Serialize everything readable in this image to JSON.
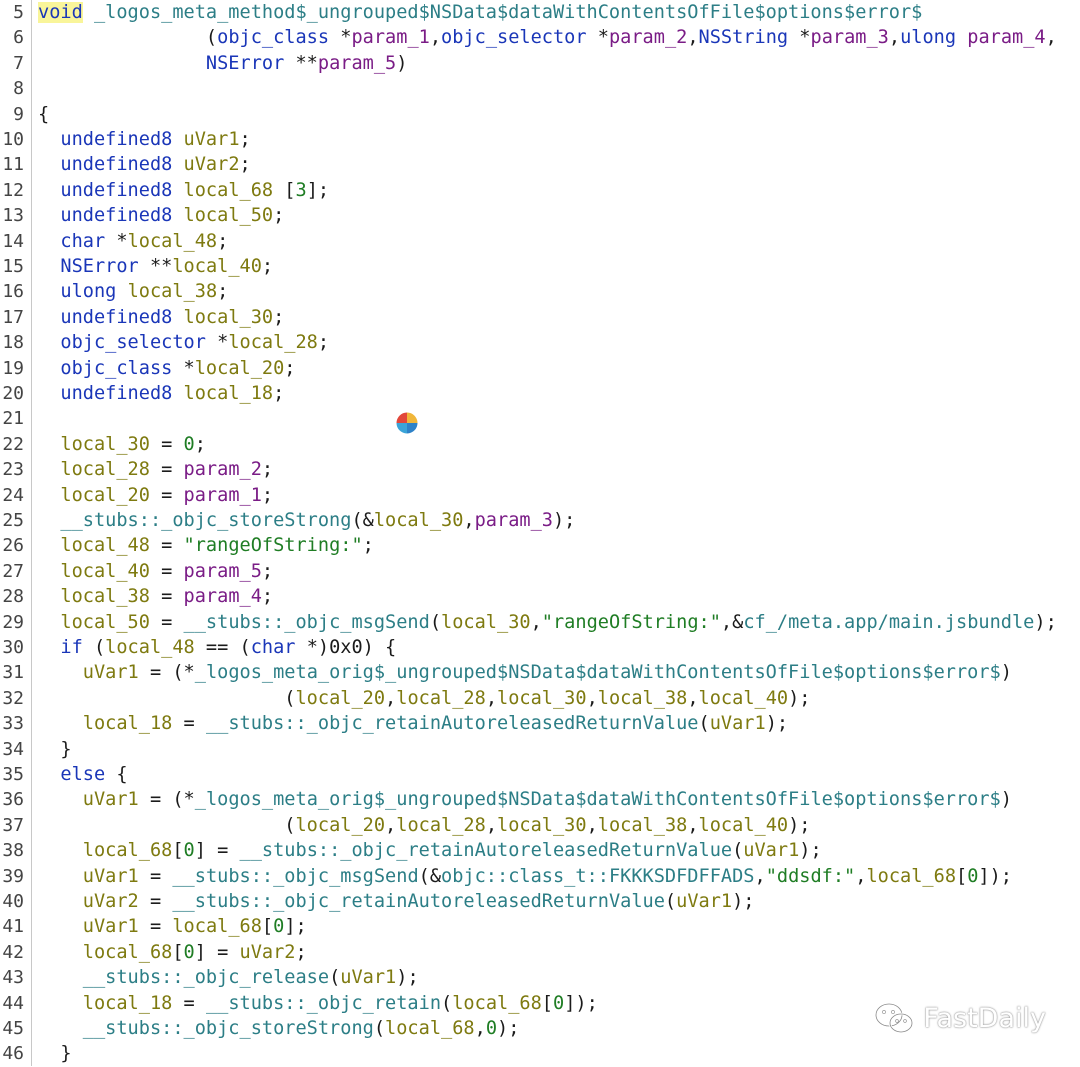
{
  "editor": {
    "lines": [
      {
        "n": "5",
        "t": [
          [
            "hl",
            "void"
          ],
          [
            "fn",
            " _logos_meta_method$_ungrouped$NSData$dataWithContentsOfFile$options$error$"
          ]
        ]
      },
      {
        "n": "6",
        "t": [
          [
            "plain",
            "               ("
          ],
          [
            "kw",
            "objc_class"
          ],
          [
            "plain",
            " *"
          ],
          [
            "param",
            "param_1"
          ],
          [
            "plain",
            ","
          ],
          [
            "kw",
            "objc_selector"
          ],
          [
            "plain",
            " *"
          ],
          [
            "param",
            "param_2"
          ],
          [
            "plain",
            ","
          ],
          [
            "kw",
            "NSString"
          ],
          [
            "plain",
            " *"
          ],
          [
            "param",
            "param_3"
          ],
          [
            "plain",
            ","
          ],
          [
            "kw",
            "ulong"
          ],
          [
            "plain",
            " "
          ],
          [
            "param",
            "param_4"
          ],
          [
            "plain",
            ","
          ]
        ]
      },
      {
        "n": "7",
        "t": [
          [
            "plain",
            "               "
          ],
          [
            "kw",
            "NSError"
          ],
          [
            "plain",
            " **"
          ],
          [
            "param",
            "param_5"
          ],
          [
            "plain",
            ")"
          ]
        ]
      },
      {
        "n": "8",
        "t": []
      },
      {
        "n": "9",
        "t": [
          [
            "plain",
            "{"
          ]
        ]
      },
      {
        "n": "10",
        "t": [
          [
            "plain",
            "  "
          ],
          [
            "kw",
            "undefined8"
          ],
          [
            "plain",
            " "
          ],
          [
            "local",
            "uVar1"
          ],
          [
            "plain",
            ";"
          ]
        ]
      },
      {
        "n": "11",
        "t": [
          [
            "plain",
            "  "
          ],
          [
            "kw",
            "undefined8"
          ],
          [
            "plain",
            " "
          ],
          [
            "local",
            "uVar2"
          ],
          [
            "plain",
            ";"
          ]
        ]
      },
      {
        "n": "12",
        "t": [
          [
            "plain",
            "  "
          ],
          [
            "kw",
            "undefined8"
          ],
          [
            "plain",
            " "
          ],
          [
            "local",
            "local_68"
          ],
          [
            "plain",
            " ["
          ],
          [
            "num",
            "3"
          ],
          [
            "plain",
            "];"
          ]
        ]
      },
      {
        "n": "13",
        "t": [
          [
            "plain",
            "  "
          ],
          [
            "kw",
            "undefined8"
          ],
          [
            "plain",
            " "
          ],
          [
            "local",
            "local_50"
          ],
          [
            "plain",
            ";"
          ]
        ]
      },
      {
        "n": "14",
        "t": [
          [
            "plain",
            "  "
          ],
          [
            "kw",
            "char"
          ],
          [
            "plain",
            " *"
          ],
          [
            "local",
            "local_48"
          ],
          [
            "plain",
            ";"
          ]
        ]
      },
      {
        "n": "15",
        "t": [
          [
            "plain",
            "  "
          ],
          [
            "kw",
            "NSError"
          ],
          [
            "plain",
            " **"
          ],
          [
            "local",
            "local_40"
          ],
          [
            "plain",
            ";"
          ]
        ]
      },
      {
        "n": "16",
        "t": [
          [
            "plain",
            "  "
          ],
          [
            "kw",
            "ulong"
          ],
          [
            "plain",
            " "
          ],
          [
            "local",
            "local_38"
          ],
          [
            "plain",
            ";"
          ]
        ]
      },
      {
        "n": "17",
        "t": [
          [
            "plain",
            "  "
          ],
          [
            "kw",
            "undefined8"
          ],
          [
            "plain",
            " "
          ],
          [
            "local",
            "local_30"
          ],
          [
            "plain",
            ";"
          ]
        ]
      },
      {
        "n": "18",
        "t": [
          [
            "plain",
            "  "
          ],
          [
            "kw",
            "objc_selector"
          ],
          [
            "plain",
            " *"
          ],
          [
            "local",
            "local_28"
          ],
          [
            "plain",
            ";"
          ]
        ]
      },
      {
        "n": "19",
        "t": [
          [
            "plain",
            "  "
          ],
          [
            "kw",
            "objc_class"
          ],
          [
            "plain",
            " *"
          ],
          [
            "local",
            "local_20"
          ],
          [
            "plain",
            ";"
          ]
        ]
      },
      {
        "n": "20",
        "t": [
          [
            "plain",
            "  "
          ],
          [
            "kw",
            "undefined8"
          ],
          [
            "plain",
            " "
          ],
          [
            "local",
            "local_18"
          ],
          [
            "plain",
            ";"
          ]
        ]
      },
      {
        "n": "21",
        "t": []
      },
      {
        "n": "22",
        "t": [
          [
            "plain",
            "  "
          ],
          [
            "local",
            "local_30"
          ],
          [
            "plain",
            " = "
          ],
          [
            "num",
            "0"
          ],
          [
            "plain",
            ";"
          ]
        ]
      },
      {
        "n": "23",
        "t": [
          [
            "plain",
            "  "
          ],
          [
            "local",
            "local_28"
          ],
          [
            "plain",
            " = "
          ],
          [
            "param",
            "param_2"
          ],
          [
            "plain",
            ";"
          ]
        ]
      },
      {
        "n": "24",
        "t": [
          [
            "plain",
            "  "
          ],
          [
            "local",
            "local_20"
          ],
          [
            "plain",
            " = "
          ],
          [
            "param",
            "param_1"
          ],
          [
            "plain",
            ";"
          ]
        ]
      },
      {
        "n": "25",
        "t": [
          [
            "plain",
            "  "
          ],
          [
            "fn",
            "__stubs::_objc_storeStrong"
          ],
          [
            "plain",
            "(&"
          ],
          [
            "local",
            "local_30"
          ],
          [
            "plain",
            ","
          ],
          [
            "param",
            "param_3"
          ],
          [
            "plain",
            ");"
          ]
        ]
      },
      {
        "n": "26",
        "t": [
          [
            "plain",
            "  "
          ],
          [
            "local",
            "local_48"
          ],
          [
            "plain",
            " = "
          ],
          [
            "str",
            "\"rangeOfString:\""
          ],
          [
            "plain",
            ";"
          ]
        ]
      },
      {
        "n": "27",
        "t": [
          [
            "plain",
            "  "
          ],
          [
            "local",
            "local_40"
          ],
          [
            "plain",
            " = "
          ],
          [
            "param",
            "param_5"
          ],
          [
            "plain",
            ";"
          ]
        ]
      },
      {
        "n": "28",
        "t": [
          [
            "plain",
            "  "
          ],
          [
            "local",
            "local_38"
          ],
          [
            "plain",
            " = "
          ],
          [
            "param",
            "param_4"
          ],
          [
            "plain",
            ";"
          ]
        ]
      },
      {
        "n": "29",
        "t": [
          [
            "plain",
            "  "
          ],
          [
            "local",
            "local_50"
          ],
          [
            "plain",
            " = "
          ],
          [
            "fn",
            "__stubs::_objc_msgSend"
          ],
          [
            "plain",
            "("
          ],
          [
            "local",
            "local_30"
          ],
          [
            "plain",
            ","
          ],
          [
            "str",
            "\"rangeOfString:\""
          ],
          [
            "plain",
            ",&"
          ],
          [
            "fn",
            "cf_/meta.app/main.jsbundle"
          ],
          [
            "plain",
            ");"
          ]
        ]
      },
      {
        "n": "30",
        "t": [
          [
            "plain",
            "  "
          ],
          [
            "kw",
            "if"
          ],
          [
            "plain",
            " ("
          ],
          [
            "local",
            "local_48"
          ],
          [
            "plain",
            " == ("
          ],
          [
            "kw",
            "char"
          ],
          [
            "plain",
            " *)0x0) {"
          ]
        ]
      },
      {
        "n": "31",
        "t": [
          [
            "plain",
            "    "
          ],
          [
            "local",
            "uVar1"
          ],
          [
            "plain",
            " = (*"
          ],
          [
            "fn",
            "_logos_meta_orig$_ungrouped$NSData$dataWithContentsOfFile$options$error$"
          ],
          [
            "plain",
            ")"
          ]
        ]
      },
      {
        "n": "32",
        "t": [
          [
            "plain",
            "                      ("
          ],
          [
            "local",
            "local_20"
          ],
          [
            "plain",
            ","
          ],
          [
            "local",
            "local_28"
          ],
          [
            "plain",
            ","
          ],
          [
            "local",
            "local_30"
          ],
          [
            "plain",
            ","
          ],
          [
            "local",
            "local_38"
          ],
          [
            "plain",
            ","
          ],
          [
            "local",
            "local_40"
          ],
          [
            "plain",
            ");"
          ]
        ]
      },
      {
        "n": "33",
        "t": [
          [
            "plain",
            "    "
          ],
          [
            "local",
            "local_18"
          ],
          [
            "plain",
            " = "
          ],
          [
            "fn",
            "__stubs::_objc_retainAutoreleasedReturnValue"
          ],
          [
            "plain",
            "("
          ],
          [
            "local",
            "uVar1"
          ],
          [
            "plain",
            ");"
          ]
        ]
      },
      {
        "n": "34",
        "t": [
          [
            "plain",
            "  }"
          ]
        ]
      },
      {
        "n": "35",
        "t": [
          [
            "plain",
            "  "
          ],
          [
            "kw",
            "else"
          ],
          [
            "plain",
            " {"
          ]
        ]
      },
      {
        "n": "36",
        "t": [
          [
            "plain",
            "    "
          ],
          [
            "local",
            "uVar1"
          ],
          [
            "plain",
            " = (*"
          ],
          [
            "fn",
            "_logos_meta_orig$_ungrouped$NSData$dataWithContentsOfFile$options$error$"
          ],
          [
            "plain",
            ")"
          ]
        ]
      },
      {
        "n": "37",
        "t": [
          [
            "plain",
            "                      ("
          ],
          [
            "local",
            "local_20"
          ],
          [
            "plain",
            ","
          ],
          [
            "local",
            "local_28"
          ],
          [
            "plain",
            ","
          ],
          [
            "local",
            "local_30"
          ],
          [
            "plain",
            ","
          ],
          [
            "local",
            "local_38"
          ],
          [
            "plain",
            ","
          ],
          [
            "local",
            "local_40"
          ],
          [
            "plain",
            ");"
          ]
        ]
      },
      {
        "n": "38",
        "t": [
          [
            "plain",
            "    "
          ],
          [
            "local",
            "local_68"
          ],
          [
            "plain",
            "["
          ],
          [
            "num",
            "0"
          ],
          [
            "plain",
            "] = "
          ],
          [
            "fn",
            "__stubs::_objc_retainAutoreleasedReturnValue"
          ],
          [
            "plain",
            "("
          ],
          [
            "local",
            "uVar1"
          ],
          [
            "plain",
            ");"
          ]
        ]
      },
      {
        "n": "39",
        "t": [
          [
            "plain",
            "    "
          ],
          [
            "local",
            "uVar1"
          ],
          [
            "plain",
            " = "
          ],
          [
            "fn",
            "__stubs::_objc_msgSend"
          ],
          [
            "plain",
            "(&"
          ],
          [
            "fn",
            "objc::class_t::FKKKSDFDFFADS"
          ],
          [
            "plain",
            ","
          ],
          [
            "str",
            "\"ddsdf:\""
          ],
          [
            "plain",
            ","
          ],
          [
            "local",
            "local_68"
          ],
          [
            "plain",
            "["
          ],
          [
            "num",
            "0"
          ],
          [
            "plain",
            "]);"
          ]
        ]
      },
      {
        "n": "40",
        "t": [
          [
            "plain",
            "    "
          ],
          [
            "local",
            "uVar2"
          ],
          [
            "plain",
            " = "
          ],
          [
            "fn",
            "__stubs::_objc_retainAutoreleasedReturnValue"
          ],
          [
            "plain",
            "("
          ],
          [
            "local",
            "uVar1"
          ],
          [
            "plain",
            ");"
          ]
        ]
      },
      {
        "n": "41",
        "t": [
          [
            "plain",
            "    "
          ],
          [
            "local",
            "uVar1"
          ],
          [
            "plain",
            " = "
          ],
          [
            "local",
            "local_68"
          ],
          [
            "plain",
            "["
          ],
          [
            "num",
            "0"
          ],
          [
            "plain",
            "];"
          ]
        ]
      },
      {
        "n": "42",
        "t": [
          [
            "plain",
            "    "
          ],
          [
            "local",
            "local_68"
          ],
          [
            "plain",
            "["
          ],
          [
            "num",
            "0"
          ],
          [
            "plain",
            "] = "
          ],
          [
            "local",
            "uVar2"
          ],
          [
            "plain",
            ";"
          ]
        ]
      },
      {
        "n": "43",
        "t": [
          [
            "plain",
            "    "
          ],
          [
            "fn",
            "__stubs::_objc_release"
          ],
          [
            "plain",
            "("
          ],
          [
            "local",
            "uVar1"
          ],
          [
            "plain",
            ");"
          ]
        ]
      },
      {
        "n": "44",
        "t": [
          [
            "plain",
            "    "
          ],
          [
            "local",
            "local_18"
          ],
          [
            "plain",
            " = "
          ],
          [
            "fn",
            "__stubs::_objc_retain"
          ],
          [
            "plain",
            "("
          ],
          [
            "local",
            "local_68"
          ],
          [
            "plain",
            "["
          ],
          [
            "num",
            "0"
          ],
          [
            "plain",
            "]);"
          ]
        ]
      },
      {
        "n": "45",
        "t": [
          [
            "plain",
            "    "
          ],
          [
            "fn",
            "__stubs::_objc_storeStrong"
          ],
          [
            "plain",
            "("
          ],
          [
            "local",
            "local_68"
          ],
          [
            "plain",
            ","
          ],
          [
            "num",
            "0"
          ],
          [
            "plain",
            ");"
          ]
        ]
      },
      {
        "n": "46",
        "t": [
          [
            "plain",
            "  }"
          ]
        ]
      }
    ]
  },
  "watermark": {
    "text": "FastDaily",
    "icon": "wechat-icon"
  },
  "cursor": {
    "icon": "spinning-wait-cursor-icon"
  },
  "colors": {
    "keyword": "#1a36b8",
    "function": "#2c7e86",
    "param": "#7a1c86",
    "local": "#7e7a10",
    "string": "#1f7d24",
    "highlight": "#f9f59a"
  }
}
